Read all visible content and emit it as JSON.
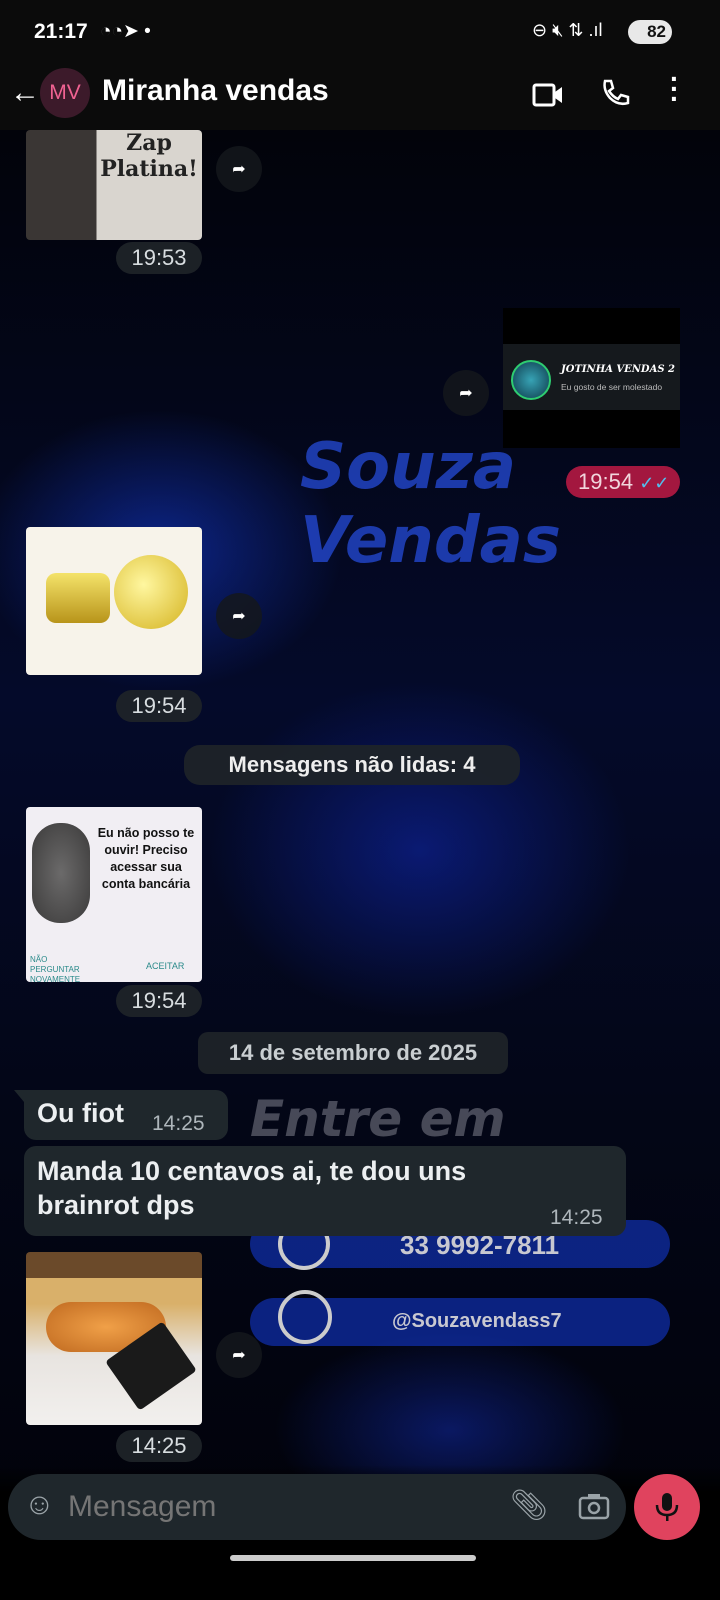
{
  "status_bar": {
    "time": "21:17",
    "battery": "82"
  },
  "header": {
    "avatar_initials": "MV",
    "contact_name": "Miranha vendas"
  },
  "wallpaper": {
    "brand_script": "Souza Vendas",
    "phone": "33 9992-7811",
    "instagram": "@Souzavendass7",
    "cta": "Entre em Contato"
  },
  "messages": [
    {
      "type": "sticker",
      "direction": "in",
      "caption": "Zap Platina!",
      "time": "19:53"
    },
    {
      "type": "sticker",
      "direction": "out",
      "card_title": "JOTINHA VENDAS 2",
      "card_subtitle": "Eu gosto de ser molestado",
      "time": "19:54",
      "status": "read"
    },
    {
      "type": "sticker",
      "direction": "in",
      "description": "thumbs-up emoji",
      "time": "19:54"
    },
    {
      "type": "sticker",
      "direction": "in",
      "text": "Eu não posso te ouvir! Preciso acessar sua conta bancária",
      "left_button": "NÃO PERGUNTAR NOVAMENTE",
      "right_button": "ACEITAR",
      "time": "19:54"
    },
    {
      "type": "text",
      "direction": "in",
      "text": "Ou fiot",
      "time": "14:25"
    },
    {
      "type": "text",
      "direction": "in",
      "text": "Manda 10 centavos ai, te dou uns brainrot dps",
      "time": "14:25"
    },
    {
      "type": "image",
      "direction": "in",
      "time": "14:25"
    }
  ],
  "unread_divider": "Mensagens não lidas: 4",
  "date_divider": "14 de setembro de 2025",
  "composer": {
    "placeholder": "Mensagem"
  },
  "colors": {
    "outgoing_time_pill": "#a3173f",
    "mic_button": "#e0435e",
    "incoming_bubble": "#1f272c",
    "read_ticks": "#53bdeb"
  }
}
